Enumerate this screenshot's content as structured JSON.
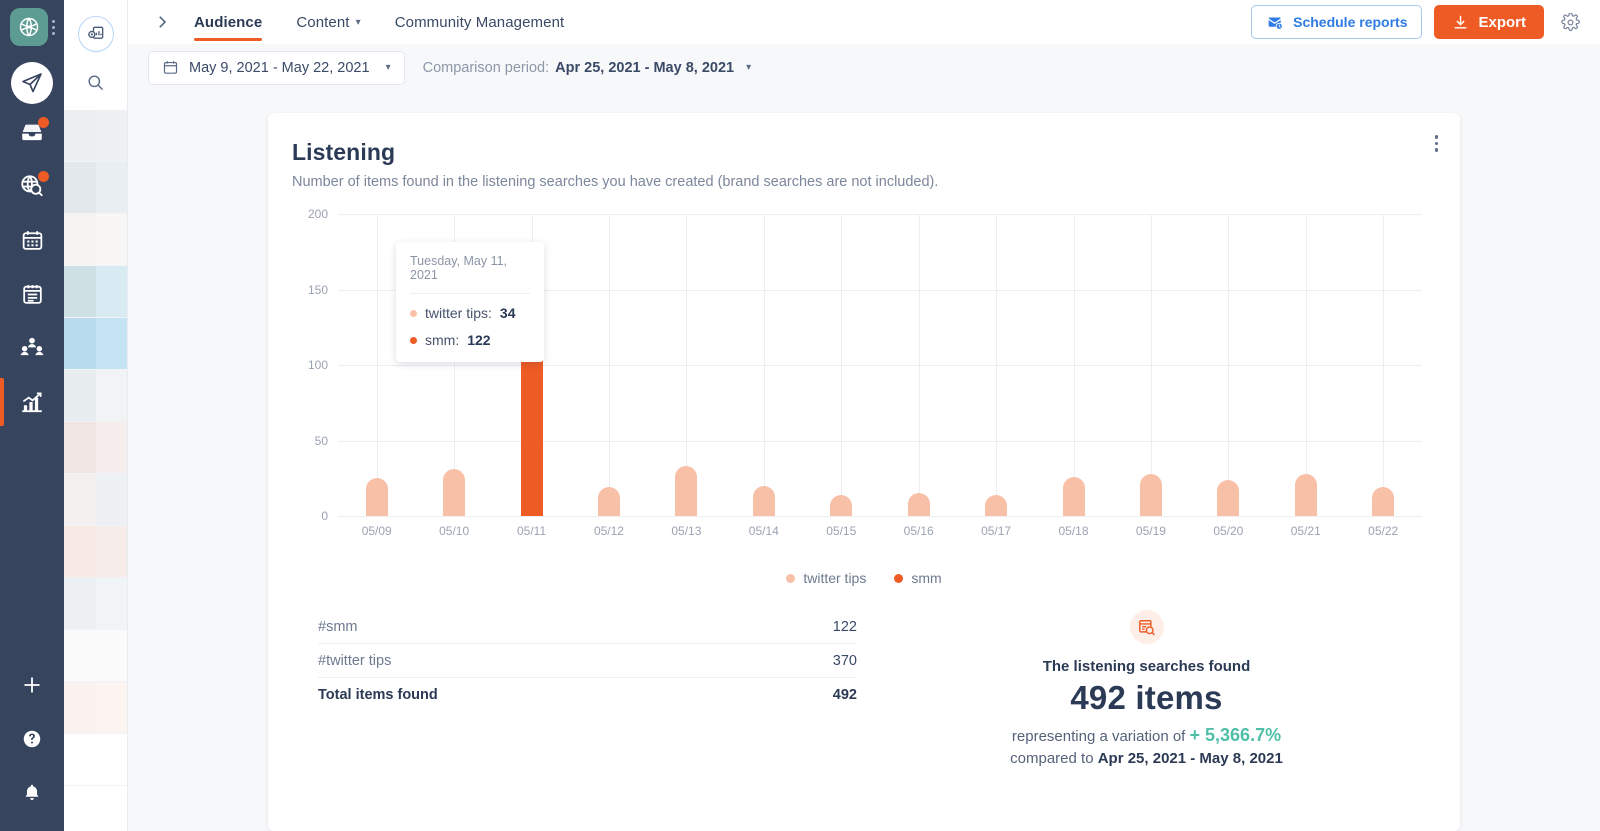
{
  "rail": {
    "logo_icon": "brand-logo-icon",
    "items": [
      {
        "name": "compose",
        "icon": "paper-plane-icon",
        "badge": false,
        "active": false
      },
      {
        "name": "inbox",
        "icon": "inbox-icon",
        "badge": true,
        "active": false
      },
      {
        "name": "listening",
        "icon": "globe-search-icon",
        "badge": true,
        "active": false
      },
      {
        "name": "calendar",
        "icon": "calendar-icon",
        "badge": false,
        "active": false
      },
      {
        "name": "publishing",
        "icon": "notepad-icon",
        "badge": false,
        "active": false
      },
      {
        "name": "community",
        "icon": "people-icon",
        "badge": false,
        "active": false
      },
      {
        "name": "analytics",
        "icon": "bar-chart-icon",
        "badge": false,
        "active": true
      }
    ],
    "bottom_items": [
      {
        "name": "add",
        "icon": "plus-icon"
      },
      {
        "name": "help",
        "icon": "question-circle-icon"
      },
      {
        "name": "notifications",
        "icon": "bell-icon"
      }
    ]
  },
  "panel2": {
    "report_icon": "report-chart-icon",
    "search_icon": "search-icon",
    "ghost_rows": [
      [
        "#eceef0",
        "#eef1f3"
      ],
      [
        "#e2e8ec",
        "#e8eef2"
      ],
      [
        "#f6f4f3",
        "#f8f7f6"
      ],
      [
        "#cfe0e4",
        "#d8eaf2"
      ],
      [
        "#b8dcee",
        "#c4e4f6"
      ],
      [
        "#e8edf0",
        "#f2f3f4"
      ],
      [
        "#f0e5e2",
        "#f5eeec"
      ],
      [
        "#f2f1f0",
        "#eef1f4"
      ],
      [
        "#f7e9e4",
        "#f6ece9"
      ],
      [
        "#eef1f3",
        "#f1f4f7"
      ],
      [
        "#fafafa",
        "#fbfbfb"
      ],
      [
        "#faf2ef",
        "#fbf4f1"
      ],
      [
        "#ffffff",
        "#ffffff"
      ]
    ]
  },
  "topbar": {
    "expand_icon": "chevron-right-icon",
    "tabs": [
      {
        "label": "Audience",
        "active": true,
        "has_caret": false
      },
      {
        "label": "Content",
        "active": false,
        "has_caret": true
      },
      {
        "label": "Community Management",
        "active": false,
        "has_caret": false
      }
    ],
    "schedule_label": "Schedule reports",
    "schedule_icon": "envelope-clock-icon",
    "export_label": "Export",
    "export_icon": "download-icon",
    "gear_icon": "gear-icon",
    "accent": "#ef5b25",
    "link_blue": "#2e7ce4"
  },
  "subbar": {
    "calendar_icon": "calendar-icon",
    "date_range": "May 9, 2021 - May 22, 2021",
    "date_caret_icon": "chevron-down-icon",
    "comparison_label": "Comparison period:",
    "comparison_value": "Apr 25, 2021 - May 8, 2021",
    "comparison_caret_icon": "chevron-down-icon"
  },
  "card": {
    "title": "Listening",
    "subtitle": "Number of items found in the listening searches you have created (brand searches are not included).",
    "menu_icon": "kebab-menu-icon"
  },
  "tooltip": {
    "date": "Tuesday, May 11, 2021",
    "rows": [
      {
        "label": "twitter tips:",
        "value": "34",
        "color": "#f7c0a7"
      },
      {
        "label": "smm:",
        "value": "122",
        "color": "#ef5b25"
      }
    ]
  },
  "chart_data": {
    "type": "bar",
    "stacked": true,
    "title": "Listening",
    "xlabel": "",
    "ylabel": "",
    "ylim": [
      0,
      200
    ],
    "yticks": [
      0,
      50,
      100,
      150,
      200
    ],
    "grid": true,
    "legend_position": "bottom",
    "categories": [
      "05/09",
      "05/10",
      "05/11",
      "05/12",
      "05/13",
      "05/14",
      "05/15",
      "05/16",
      "05/17",
      "05/18",
      "05/19",
      "05/20",
      "05/21",
      "05/22"
    ],
    "series": [
      {
        "name": "twitter tips",
        "color": "#f7c0a7",
        "values": [
          25,
          31,
          34,
          19,
          33,
          20,
          14,
          15,
          14,
          26,
          28,
          24,
          28,
          19
        ]
      },
      {
        "name": "smm",
        "color": "#ef5b25",
        "values": [
          0,
          0,
          122,
          0,
          0,
          0,
          0,
          0,
          0,
          0,
          0,
          0,
          0,
          0
        ]
      }
    ],
    "highlighted_category": "05/11"
  },
  "table": {
    "rows": [
      {
        "label": "#smm",
        "value": "122"
      },
      {
        "label": "#twitter tips",
        "value": "370"
      }
    ],
    "total": {
      "label": "Total items found",
      "value": "492"
    }
  },
  "summary": {
    "icon": "listening-search-icon",
    "line1": "The listening searches found",
    "big": "492 items",
    "line3_prefix": "representing a variation of ",
    "variation": "+ 5,366.7%",
    "line4_prefix": "compared to ",
    "compare_range": "Apr 25, 2021 - May 8, 2021",
    "variation_color": "#4fbfa8"
  }
}
